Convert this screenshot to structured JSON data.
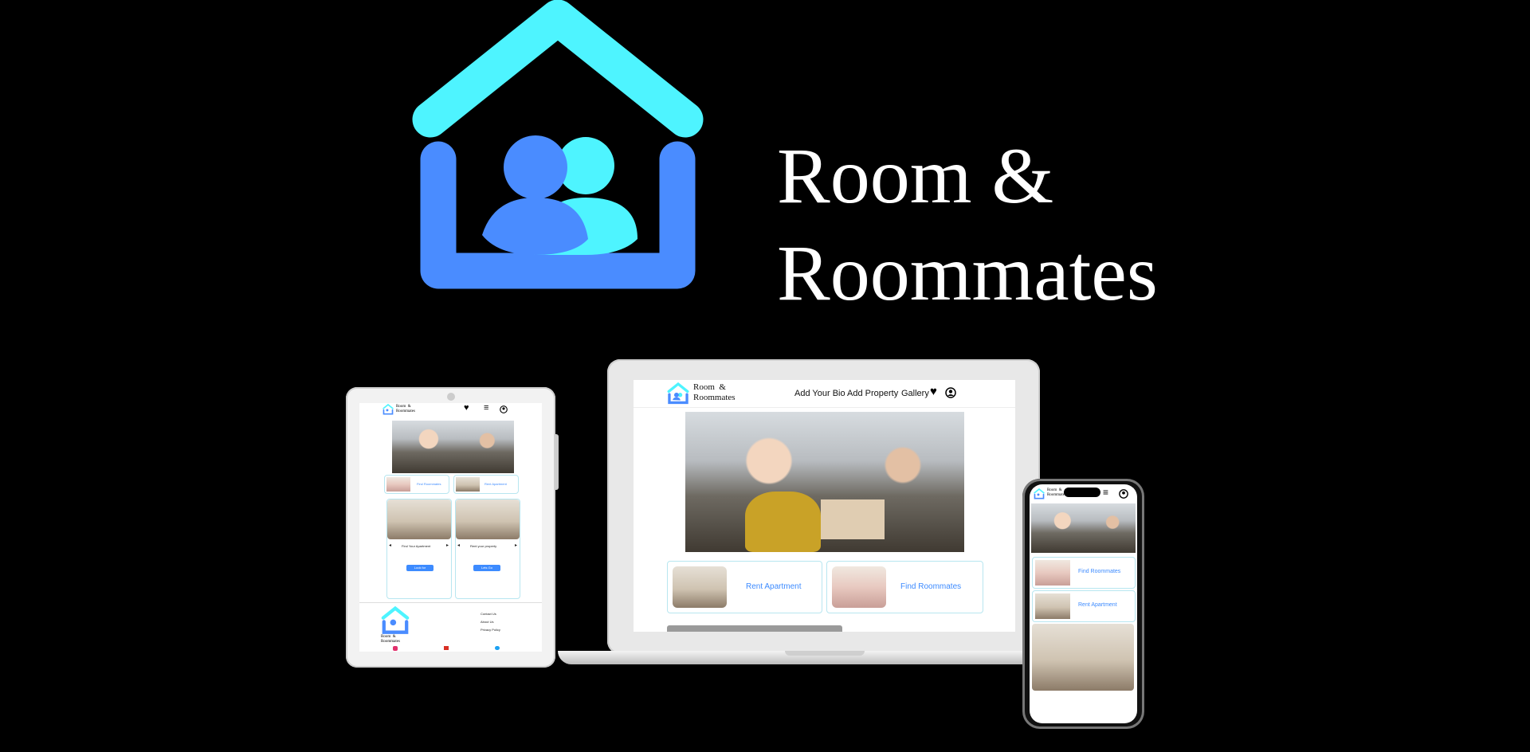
{
  "brand": {
    "title_line1": "Room  &",
    "title_line2": "Roommates",
    "colors": {
      "roof": "#4ef4ff",
      "frame": "#4a8cff",
      "person_front": "#4a8cff",
      "person_back": "#4ef4ff"
    }
  },
  "desktop": {
    "logo_line1": "Room  &",
    "logo_line2": "Roommates",
    "nav": [
      "Add Your Bio",
      "Add Property",
      "Gallery"
    ],
    "cards": [
      "Rent Apartment",
      "Find Roommates"
    ]
  },
  "tablet": {
    "logo_line1": "Room  &",
    "logo_line2": "Roommates",
    "cards": [
      "Find Roommates",
      "Rent Apartment"
    ],
    "listing_titles": [
      "Find Your Apartment",
      "Rent your property"
    ],
    "listing_buttons": [
      "Look for",
      "Lets Go"
    ],
    "footer_links": [
      "Contact Us",
      "About Us",
      "Privacy Policy"
    ],
    "footer_logo_line1": "Room  &",
    "footer_logo_line2": "Roommates"
  },
  "phone": {
    "logo_line1": "Room  &",
    "logo_line2": "Roommates",
    "cards": [
      "Find Roommates",
      "Rent Apartment"
    ]
  }
}
